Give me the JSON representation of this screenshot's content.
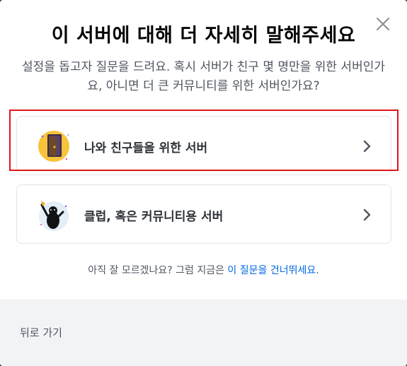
{
  "modal": {
    "title": "이 서버에 대해 더 자세히 말해주세요",
    "subtitle": "설정을 돕고자 질문을 드려요. 혹시 서버가 친구 몇 명만을 위한 서버인가요, 아니면 더 큰 커뮤니티를 위한 서버인가요?",
    "close_icon": "close-icon"
  },
  "options": [
    {
      "label": "나와 친구들을 위한 서버",
      "icon": "friends-door-icon"
    },
    {
      "label": "클럽, 혹은 커뮤니티용 서버",
      "icon": "club-community-icon"
    }
  ],
  "skip": {
    "prefix": "아직 잘 모르겠나요? 그럼 지금은 ",
    "link": "이 질문을 건너뛰세요",
    "suffix": "."
  },
  "footer": {
    "back_label": "뒤로 가기"
  },
  "colors": {
    "link": "#0068e0",
    "highlight": "#e0141a",
    "footer_bg": "#f2f3f5"
  }
}
